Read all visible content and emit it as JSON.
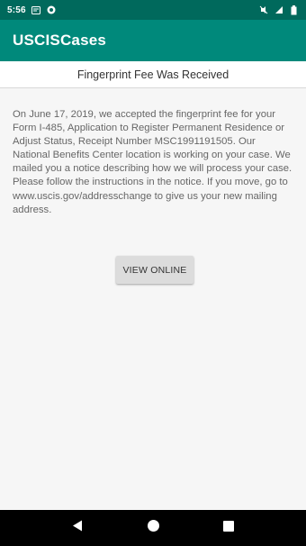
{
  "status_bar": {
    "time": "5:56",
    "left_icons": [
      "message-icon",
      "camera-icon"
    ],
    "right_icons": [
      "mute-icon",
      "signal-icon",
      "battery-icon"
    ]
  },
  "app_bar": {
    "title": "USCISCases"
  },
  "case": {
    "title": "Fingerprint Fee Was Received",
    "description": "On June 17, 2019, we accepted the fingerprint fee for your Form I-485, Application to Register Permanent Residence or Adjust Status, Receipt Number MSC1991191505. Our National Benefits Center location is working on your case. We mailed you a notice describing how we will process your case. Please follow the instructions in the notice. If you move, go to www.uscis.gov/addresschange to give us your new mailing address.",
    "button_label": "VIEW ONLINE"
  },
  "nav_bar": {
    "buttons": [
      "back-icon",
      "home-icon",
      "recents-icon"
    ]
  },
  "colors": {
    "status_bar": "#00695c",
    "app_bar": "#00897b",
    "background": "#f6f6f6",
    "button": "#dcdcdc"
  }
}
